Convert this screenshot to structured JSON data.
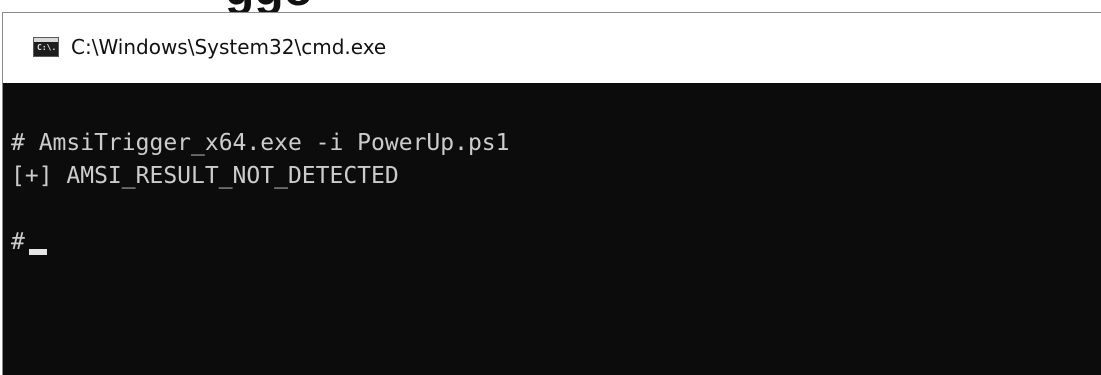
{
  "background": {
    "partial_text": "ggo"
  },
  "window": {
    "title": "C:\\Windows\\System32\\cmd.exe",
    "icon": "cmd-icon",
    "icon_glyph": "C:\\."
  },
  "console": {
    "lines": [
      "# AmsiTrigger_x64.exe -i PowerUp.ps1",
      "[+] AMSI_RESULT_NOT_DETECTED",
      "",
      "#"
    ]
  },
  "colors": {
    "console_bg": "#0c0c0c",
    "console_text": "#cccccc",
    "titlebar_bg": "#ffffff"
  }
}
